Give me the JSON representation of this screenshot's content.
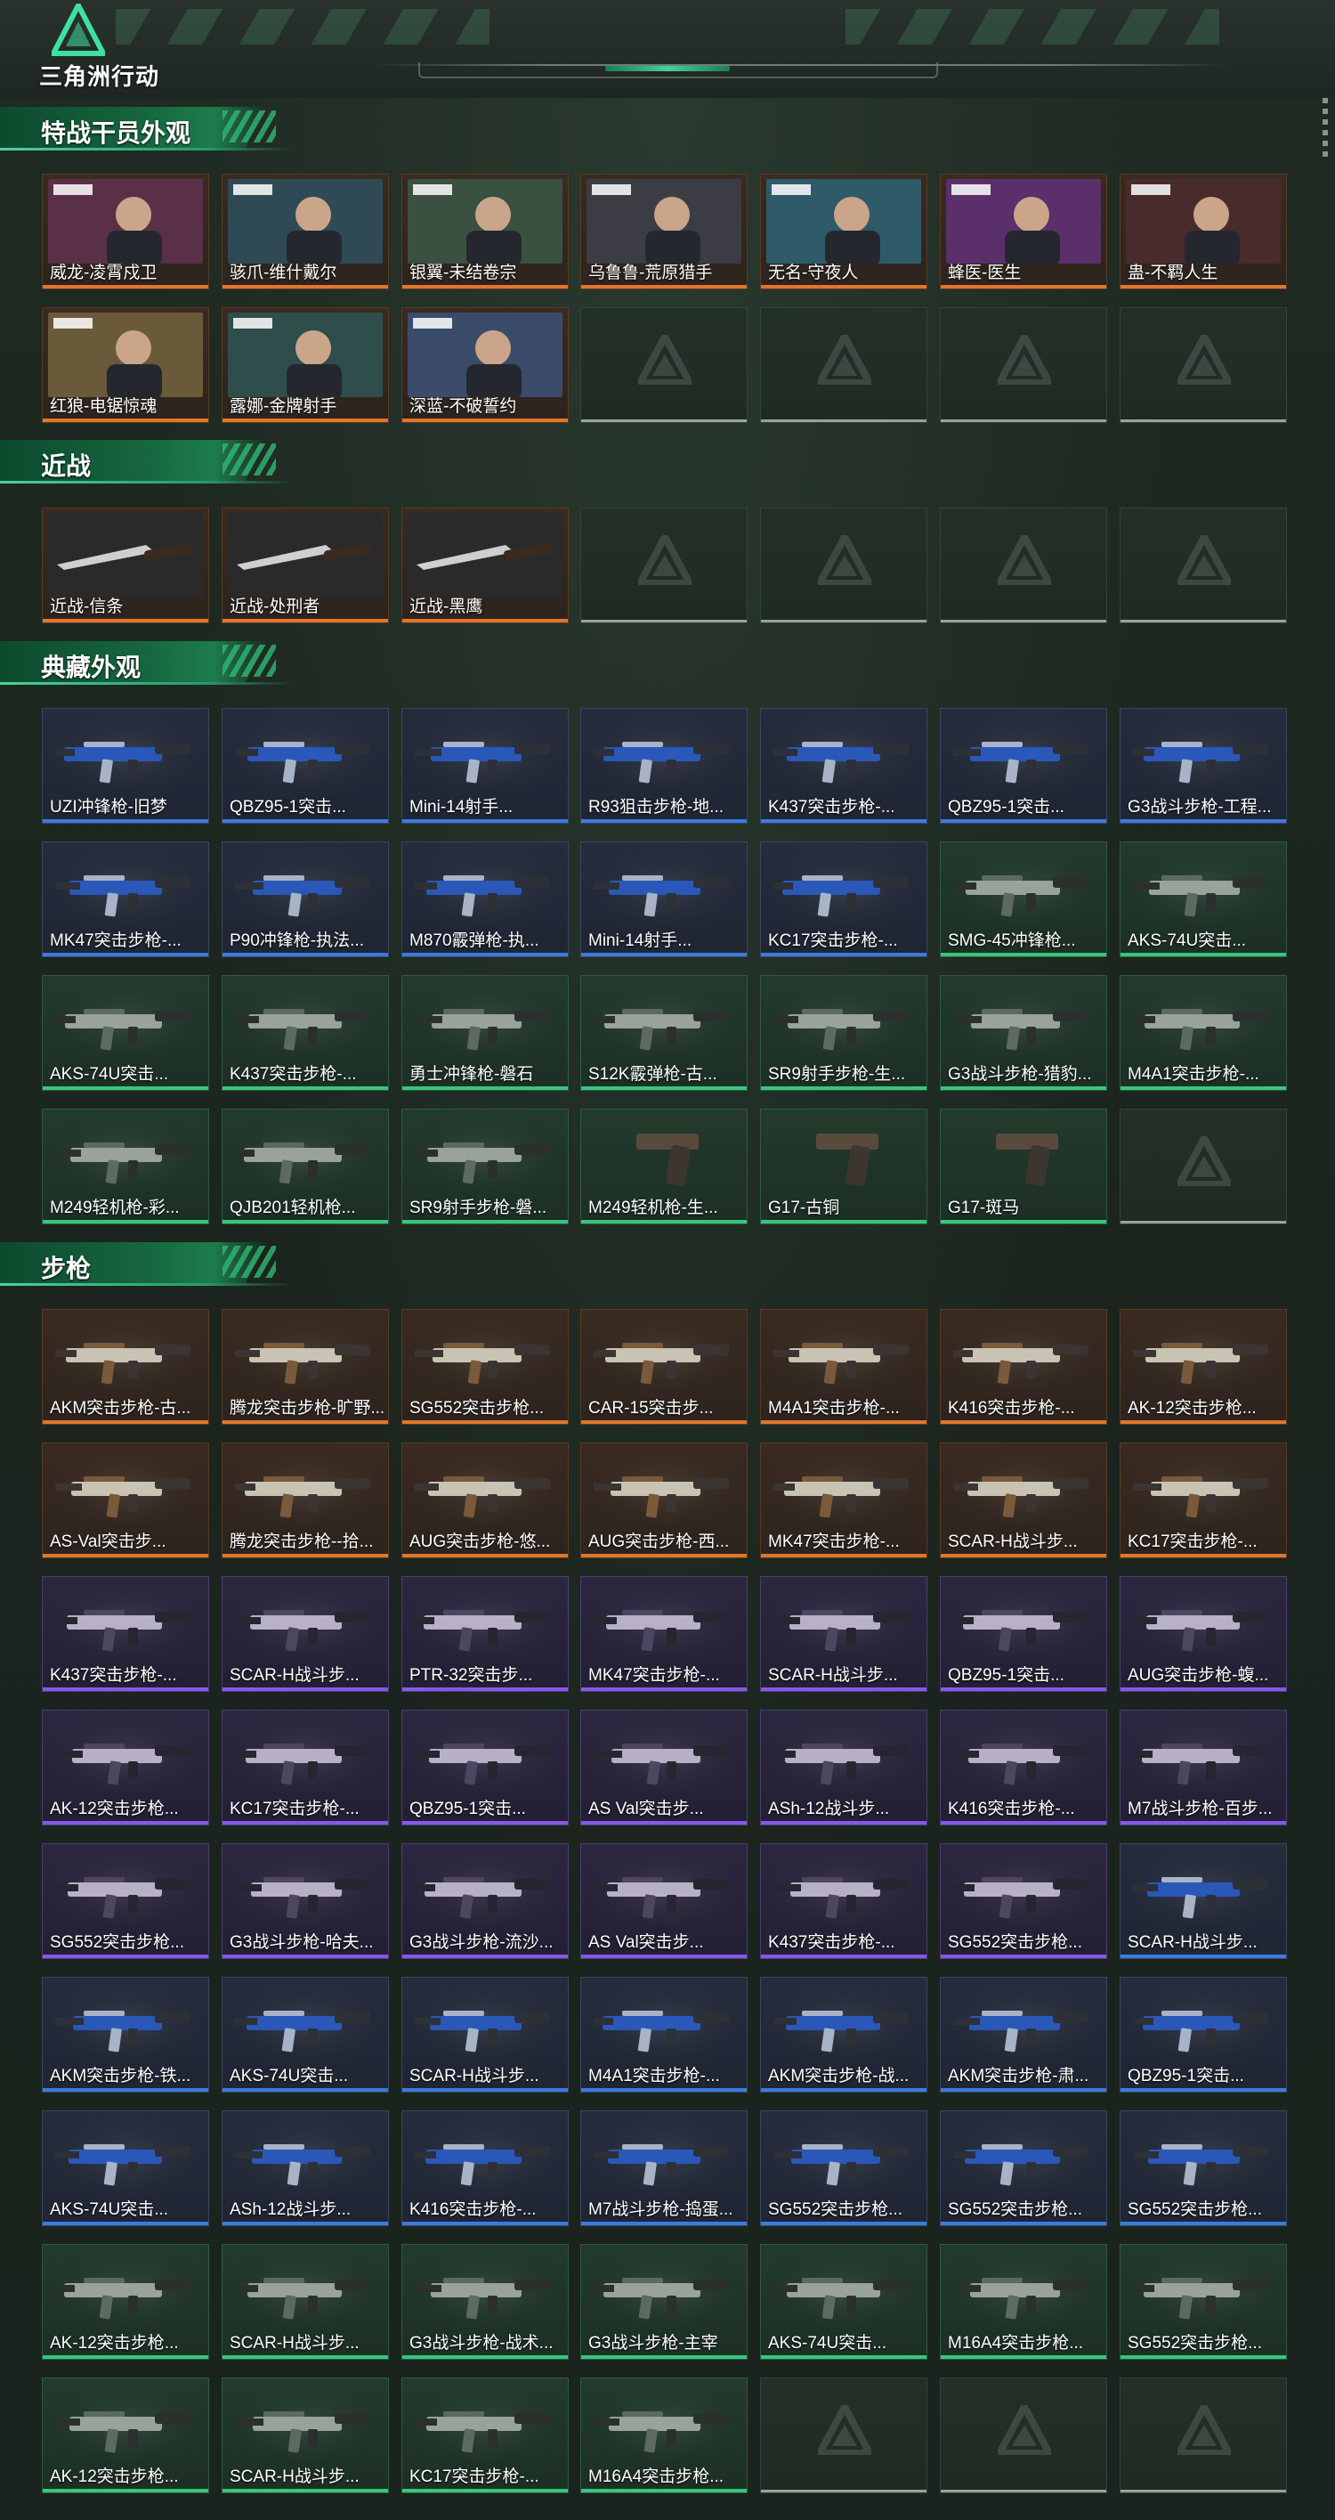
{
  "brand": {
    "name": "三角洲行动"
  },
  "sections": [
    {
      "title": "特战干员外观",
      "rows": [
        [
          {
            "label": "威龙-凌霄戍卫",
            "rarity": "orange",
            "art": "portrait"
          },
          {
            "label": "骇爪-维什戴尔",
            "rarity": "orange",
            "art": "portrait"
          },
          {
            "label": "银翼-未结卷宗",
            "rarity": "orange",
            "art": "portrait"
          },
          {
            "label": "乌鲁鲁-荒原猎手",
            "rarity": "orange",
            "art": "portrait"
          },
          {
            "label": "无名-守夜人",
            "rarity": "orange",
            "art": "portrait"
          },
          {
            "label": "蜂医-医生",
            "rarity": "orange",
            "art": "portrait"
          },
          {
            "label": "蛊-不羁人生",
            "rarity": "orange",
            "art": "portrait"
          }
        ],
        [
          {
            "label": "红狼-电锯惊魂",
            "rarity": "orange",
            "art": "portrait"
          },
          {
            "label": "露娜-金牌射手",
            "rarity": "orange",
            "art": "portrait"
          },
          {
            "label": "深蓝-不破誓约",
            "rarity": "orange",
            "art": "portrait"
          },
          {
            "rarity": "empty"
          },
          {
            "rarity": "empty"
          },
          {
            "rarity": "empty"
          },
          {
            "rarity": "empty"
          }
        ]
      ]
    },
    {
      "title": "近战",
      "rows": [
        [
          {
            "label": "近战-信条",
            "rarity": "orange",
            "art": "knife"
          },
          {
            "label": "近战-处刑者",
            "rarity": "orange",
            "art": "knife"
          },
          {
            "label": "近战-黑鹰",
            "rarity": "orange",
            "art": "knife"
          },
          {
            "rarity": "empty"
          },
          {
            "rarity": "empty"
          },
          {
            "rarity": "empty"
          },
          {
            "rarity": "empty"
          }
        ]
      ]
    },
    {
      "title": "典藏外观",
      "rows": [
        [
          {
            "label": "UZI冲锋枪-旧梦",
            "rarity": "blue",
            "art": "gun"
          },
          {
            "label": "QBZ95-1突击...",
            "rarity": "blue",
            "art": "gun"
          },
          {
            "label": "Mini-14射手...",
            "rarity": "blue",
            "art": "gun"
          },
          {
            "label": "R93狙击步枪-地...",
            "rarity": "blue",
            "art": "gun"
          },
          {
            "label": "K437突击步枪-...",
            "rarity": "blue",
            "art": "gun"
          },
          {
            "label": "QBZ95-1突击...",
            "rarity": "blue",
            "art": "gun"
          },
          {
            "label": "G3战斗步枪-工程...",
            "rarity": "blue",
            "art": "gun"
          }
        ],
        [
          {
            "label": "MK47突击步枪-...",
            "rarity": "blue",
            "art": "gun"
          },
          {
            "label": "P90冲锋枪-执法...",
            "rarity": "blue",
            "art": "gun"
          },
          {
            "label": "M870霰弹枪-执...",
            "rarity": "blue",
            "art": "gun"
          },
          {
            "label": "Mini-14射手...",
            "rarity": "blue",
            "art": "gun"
          },
          {
            "label": "KC17突击步枪-...",
            "rarity": "blue",
            "art": "gun"
          },
          {
            "label": "SMG-45冲锋枪...",
            "rarity": "green",
            "art": "gun"
          },
          {
            "label": "AKS-74U突击...",
            "rarity": "green",
            "art": "gun"
          }
        ],
        [
          {
            "label": "AKS-74U突击...",
            "rarity": "green",
            "art": "gun"
          },
          {
            "label": "K437突击步枪-...",
            "rarity": "green",
            "art": "gun"
          },
          {
            "label": "勇士冲锋枪-磐石",
            "rarity": "green",
            "art": "gun"
          },
          {
            "label": "S12K霰弹枪-古...",
            "rarity": "green",
            "art": "gun"
          },
          {
            "label": "SR9射手步枪-生...",
            "rarity": "green",
            "art": "gun"
          },
          {
            "label": "G3战斗步枪-猎豹...",
            "rarity": "green",
            "art": "gun"
          },
          {
            "label": "M4A1突击步枪-...",
            "rarity": "green",
            "art": "gun"
          }
        ],
        [
          {
            "label": "M249轻机枪-彩...",
            "rarity": "green",
            "art": "gun"
          },
          {
            "label": "QJB201轻机枪...",
            "rarity": "green",
            "art": "gun"
          },
          {
            "label": "SR9射手步枪-磐...",
            "rarity": "green",
            "art": "gun"
          },
          {
            "label": "M249轻机枪-生...",
            "rarity": "green",
            "art": "pistol"
          },
          {
            "label": "G17-古铜",
            "rarity": "green",
            "art": "pistol"
          },
          {
            "label": "G17-斑马",
            "rarity": "green",
            "art": "pistol"
          },
          {
            "rarity": "empty"
          }
        ]
      ]
    },
    {
      "title": "步枪",
      "rows": [
        [
          {
            "label": "AKM突击步枪-古...",
            "rarity": "orange",
            "art": "gun"
          },
          {
            "label": "腾龙突击步枪-旷野...",
            "rarity": "orange",
            "art": "gun"
          },
          {
            "label": "SG552突击步枪...",
            "rarity": "orange",
            "art": "gun"
          },
          {
            "label": "CAR-15突击步...",
            "rarity": "orange",
            "art": "gun"
          },
          {
            "label": "M4A1突击步枪-...",
            "rarity": "orange",
            "art": "gun"
          },
          {
            "label": "K416突击步枪-...",
            "rarity": "orange",
            "art": "gun"
          },
          {
            "label": "AK-12突击步枪...",
            "rarity": "orange",
            "art": "gun"
          }
        ],
        [
          {
            "label": "AS-Val突击步...",
            "rarity": "orange",
            "art": "gun"
          },
          {
            "label": "腾龙突击步枪--拾...",
            "rarity": "orange",
            "art": "gun"
          },
          {
            "label": "AUG突击步枪-悠...",
            "rarity": "orange",
            "art": "gun"
          },
          {
            "label": "AUG突击步枪-西...",
            "rarity": "orange",
            "art": "gun"
          },
          {
            "label": "MK47突击步枪-...",
            "rarity": "orange",
            "art": "gun"
          },
          {
            "label": "SCAR-H战斗步...",
            "rarity": "orange",
            "art": "gun"
          },
          {
            "label": "KC17突击步枪-...",
            "rarity": "orange",
            "art": "gun"
          }
        ],
        [
          {
            "label": "K437突击步枪-...",
            "rarity": "purple",
            "art": "gun"
          },
          {
            "label": "SCAR-H战斗步...",
            "rarity": "purple",
            "art": "gun"
          },
          {
            "label": "PTR-32突击步...",
            "rarity": "purple",
            "art": "gun"
          },
          {
            "label": "MK47突击步枪-...",
            "rarity": "purple",
            "art": "gun"
          },
          {
            "label": "SCAR-H战斗步...",
            "rarity": "purple",
            "art": "gun"
          },
          {
            "label": "QBZ95-1突击...",
            "rarity": "purple",
            "art": "gun"
          },
          {
            "label": "AUG突击步枪-蝮...",
            "rarity": "purple",
            "art": "gun"
          }
        ],
        [
          {
            "label": "AK-12突击步枪...",
            "rarity": "purple",
            "art": "gun"
          },
          {
            "label": "KC17突击步枪-...",
            "rarity": "purple",
            "art": "gun"
          },
          {
            "label": "QBZ95-1突击...",
            "rarity": "purple",
            "art": "gun"
          },
          {
            "label": "AS Val突击步...",
            "rarity": "purple",
            "art": "gun"
          },
          {
            "label": "ASh-12战斗步...",
            "rarity": "purple",
            "art": "gun"
          },
          {
            "label": "K416突击步枪-...",
            "rarity": "purple",
            "art": "gun"
          },
          {
            "label": "M7战斗步枪-百步...",
            "rarity": "purple",
            "art": "gun"
          }
        ],
        [
          {
            "label": "SG552突击步枪...",
            "rarity": "purple",
            "art": "gun"
          },
          {
            "label": "G3战斗步枪-哈夫...",
            "rarity": "purple",
            "art": "gun"
          },
          {
            "label": "G3战斗步枪-流沙...",
            "rarity": "purple",
            "art": "gun"
          },
          {
            "label": "AS Val突击步...",
            "rarity": "purple",
            "art": "gun"
          },
          {
            "label": "K437突击步枪-...",
            "rarity": "purple",
            "art": "gun"
          },
          {
            "label": "SG552突击步枪...",
            "rarity": "purple",
            "art": "gun"
          },
          {
            "label": "SCAR-H战斗步...",
            "rarity": "blue",
            "art": "gun"
          }
        ],
        [
          {
            "label": "AKM突击步枪-铁...",
            "rarity": "blue",
            "art": "gun"
          },
          {
            "label": "AKS-74U突击...",
            "rarity": "blue",
            "art": "gun"
          },
          {
            "label": "SCAR-H战斗步...",
            "rarity": "blue",
            "art": "gun"
          },
          {
            "label": "M4A1突击步枪-...",
            "rarity": "blue",
            "art": "gun"
          },
          {
            "label": "AKM突击步枪-战...",
            "rarity": "blue",
            "art": "gun"
          },
          {
            "label": "AKM突击步枪-肃...",
            "rarity": "blue",
            "art": "gun"
          },
          {
            "label": "QBZ95-1突击...",
            "rarity": "blue",
            "art": "gun"
          }
        ],
        [
          {
            "label": "AKS-74U突击...",
            "rarity": "blue",
            "art": "gun"
          },
          {
            "label": "ASh-12战斗步...",
            "rarity": "blue",
            "art": "gun"
          },
          {
            "label": "K416突击步枪-...",
            "rarity": "blue",
            "art": "gun"
          },
          {
            "label": "M7战斗步枪-捣蛋...",
            "rarity": "blue",
            "art": "gun"
          },
          {
            "label": "SG552突击步枪...",
            "rarity": "blue",
            "art": "gun"
          },
          {
            "label": "SG552突击步枪...",
            "rarity": "blue",
            "art": "gun"
          },
          {
            "label": "SG552突击步枪...",
            "rarity": "blue",
            "art": "gun"
          }
        ],
        [
          {
            "label": "AK-12突击步枪...",
            "rarity": "green",
            "art": "gun"
          },
          {
            "label": "SCAR-H战斗步...",
            "rarity": "green",
            "art": "gun"
          },
          {
            "label": "G3战斗步枪-战术...",
            "rarity": "green",
            "art": "gun"
          },
          {
            "label": "G3战斗步枪-主宰",
            "rarity": "green",
            "art": "gun"
          },
          {
            "label": "AKS-74U突击...",
            "rarity": "green",
            "art": "gun"
          },
          {
            "label": "M16A4突击步枪...",
            "rarity": "green",
            "art": "gun"
          },
          {
            "label": "SG552突击步枪...",
            "rarity": "green",
            "art": "gun"
          }
        ],
        [
          {
            "label": "AK-12突击步枪...",
            "rarity": "green",
            "art": "gun"
          },
          {
            "label": "SCAR-H战斗步...",
            "rarity": "green",
            "art": "gun"
          },
          {
            "label": "KC17突击步枪-...",
            "rarity": "green",
            "art": "gun"
          },
          {
            "label": "M16A4突击步枪...",
            "rarity": "green",
            "art": "gun"
          },
          {
            "rarity": "empty"
          },
          {
            "rarity": "empty"
          },
          {
            "rarity": "empty"
          }
        ]
      ]
    }
  ]
}
